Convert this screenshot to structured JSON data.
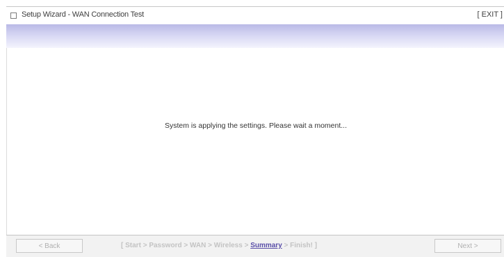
{
  "header": {
    "title": "Setup Wizard - WAN Connection Test",
    "exit_label": "[ EXIT ]"
  },
  "main": {
    "message": "System is applying the settings. Please wait a moment..."
  },
  "footer": {
    "back_label": "< Back",
    "next_label": "Next >",
    "steps": {
      "open": "[",
      "items": [
        "Start",
        "Password",
        "WAN",
        "Wireless",
        "Summary",
        "Finish!"
      ],
      "separator": ">",
      "close": "]",
      "current": "Summary"
    }
  },
  "colors": {
    "header_gradient_top": "#b9b9e6",
    "header_gradient_bottom": "#f4f4fd",
    "active_step": "#5a4fa8",
    "inactive_step": "#c3c3c3"
  }
}
